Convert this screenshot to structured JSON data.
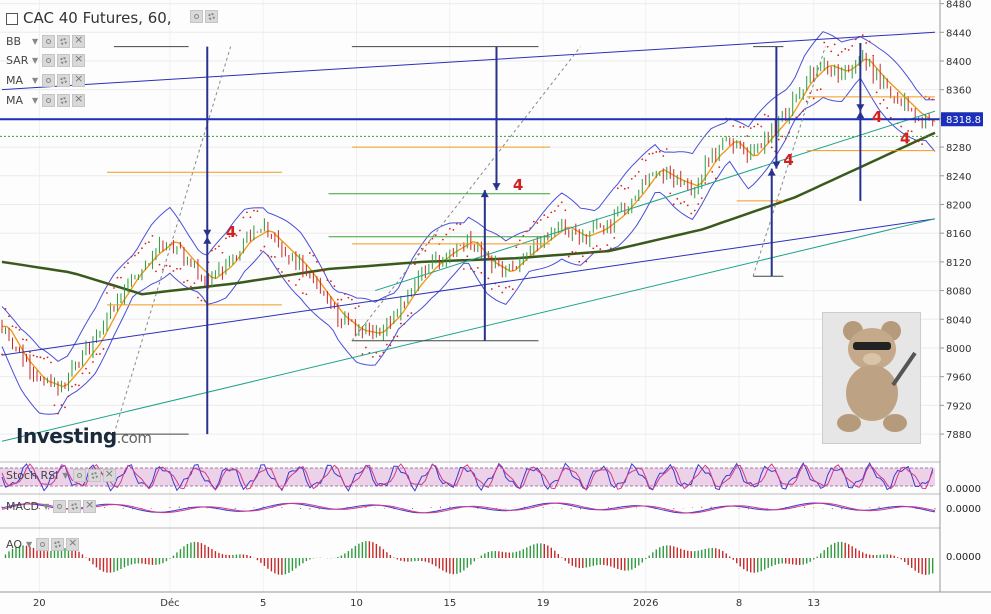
{
  "header": {
    "title": "CAC 40 Futures, 60,"
  },
  "indicators": [
    {
      "label": "BB"
    },
    {
      "label": "SAR"
    },
    {
      "label": "MA"
    },
    {
      "label": "MA"
    }
  ],
  "panes": {
    "stoch": {
      "label": "Stoch RSI",
      "value": "0.0000"
    },
    "macd": {
      "label": "MACD",
      "value": "0.0000"
    },
    "ao": {
      "label": "AO",
      "value": "0.0000"
    }
  },
  "logo": {
    "brand": "Investing",
    "suffix": ".com"
  },
  "annotations": [
    "4",
    "4",
    "4",
    "4",
    "4"
  ],
  "colors": {
    "price_line": "#1c2fb8",
    "up_candle": "#2e9b3e",
    "down_candle": "#c62828",
    "sar_dot": "#d9231f",
    "bollinger": "#4a50d6",
    "ma_long": "#3a5a1c",
    "ma_short": "#f29a1d",
    "channel_green": "#1fa38a",
    "channel_blue": "#2c2fb9",
    "target_arrow": "#28328e",
    "stoch_band": "#e6c7e2"
  },
  "chart_data": {
    "type": "candlestick",
    "title": "CAC 40 Futures, 60,",
    "x_tick_labels": [
      "20",
      "Déc",
      "5",
      "10",
      "15",
      "19",
      "2026",
      "8",
      "13"
    ],
    "y_ticks": [
      7880,
      7920,
      7960,
      8000,
      8040,
      8080,
      8120,
      8160,
      8200,
      8240,
      8280,
      8320,
      8360,
      8400,
      8440,
      8480
    ],
    "ylim": [
      7855,
      8485
    ],
    "current_price": 8318.8,
    "current_price_label": "8318.8",
    "price_path": [
      [
        0,
        8030
      ],
      [
        8,
        7985
      ],
      [
        16,
        7955
      ],
      [
        24,
        7945
      ],
      [
        32,
        7975
      ],
      [
        40,
        8010
      ],
      [
        48,
        8060
      ],
      [
        56,
        8100
      ],
      [
        64,
        8130
      ],
      [
        72,
        8150
      ],
      [
        80,
        8120
      ],
      [
        88,
        8095
      ],
      [
        96,
        8115
      ],
      [
        104,
        8150
      ],
      [
        112,
        8165
      ],
      [
        120,
        8140
      ],
      [
        128,
        8115
      ],
      [
        136,
        8080
      ],
      [
        144,
        8045
      ],
      [
        152,
        8025
      ],
      [
        160,
        8020
      ],
      [
        168,
        8045
      ],
      [
        176,
        8085
      ],
      [
        184,
        8115
      ],
      [
        192,
        8135
      ],
      [
        200,
        8150
      ],
      [
        208,
        8120
      ],
      [
        216,
        8105
      ],
      [
        224,
        8130
      ],
      [
        232,
        8150
      ],
      [
        240,
        8170
      ],
      [
        248,
        8155
      ],
      [
        256,
        8165
      ],
      [
        264,
        8185
      ],
      [
        272,
        8215
      ],
      [
        280,
        8250
      ],
      [
        288,
        8235
      ],
      [
        296,
        8225
      ],
      [
        304,
        8265
      ],
      [
        312,
        8290
      ],
      [
        320,
        8265
      ],
      [
        328,
        8295
      ],
      [
        336,
        8325
      ],
      [
        344,
        8370
      ],
      [
        352,
        8395
      ],
      [
        360,
        8385
      ],
      [
        368,
        8405
      ],
      [
        376,
        8375
      ],
      [
        384,
        8350
      ],
      [
        392,
        8325
      ],
      [
        400,
        8310
      ]
    ],
    "ma_long_path": [
      [
        0,
        8120
      ],
      [
        30,
        8105
      ],
      [
        60,
        8075
      ],
      [
        100,
        8090
      ],
      [
        140,
        8110
      ],
      [
        180,
        8120
      ],
      [
        220,
        8125
      ],
      [
        260,
        8135
      ],
      [
        300,
        8165
      ],
      [
        340,
        8210
      ],
      [
        370,
        8255
      ],
      [
        400,
        8300
      ]
    ],
    "channel_upper": {
      "from": [
        0,
        8360
      ],
      "to": [
        400,
        8440
      ]
    },
    "channel_lower": {
      "from": [
        0,
        7990
      ],
      "to": [
        400,
        8180
      ]
    },
    "channel_green_lower": {
      "from": [
        0,
        7870
      ],
      "to": [
        400,
        8180
      ]
    },
    "channel_green_upper": {
      "from": [
        160,
        8080
      ],
      "to": [
        400,
        8330
      ]
    },
    "series_sample_count": 401
  }
}
